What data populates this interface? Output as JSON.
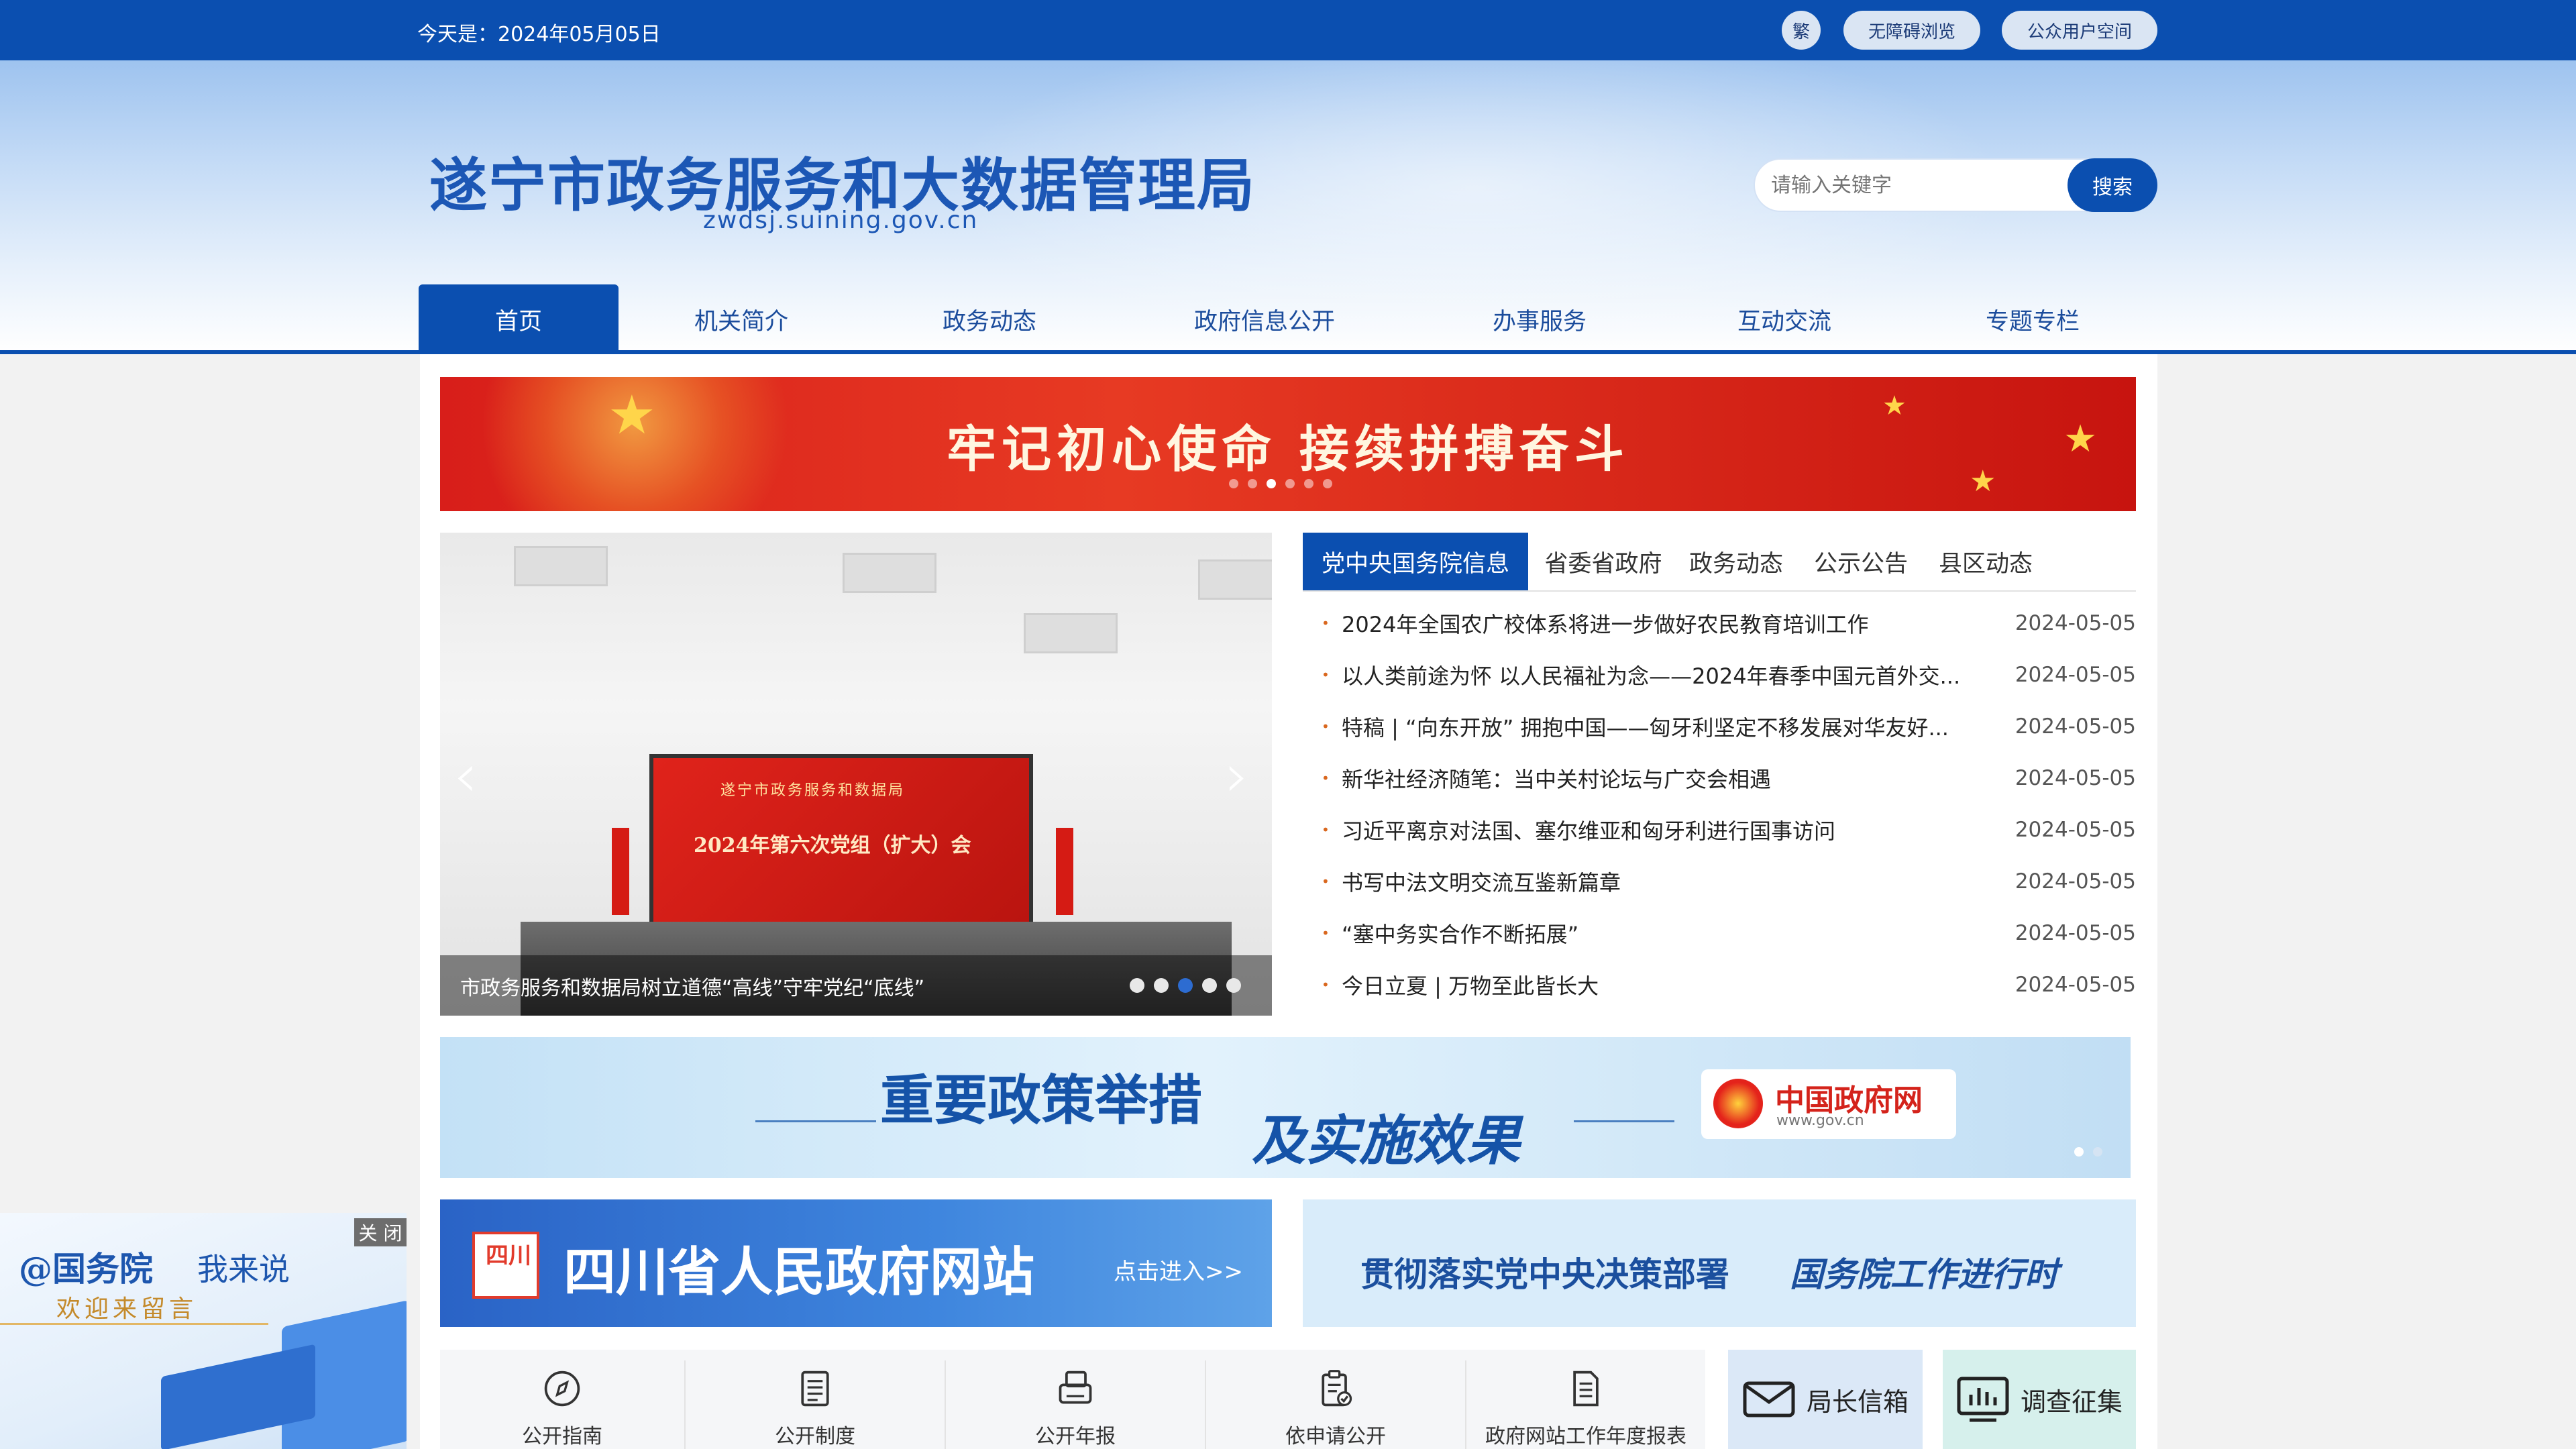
{
  "topbar": {
    "date": "今天是：2024年05月05日",
    "traditional": "繁",
    "accessibility": "无障碍浏览",
    "user_space": "公众用户空间"
  },
  "header": {
    "site_title": "遂宁市政务服务和大数据管理局",
    "domain": "zwdsj.suining.gov.cn",
    "search_placeholder": "请输入关键字",
    "search_button": "搜索"
  },
  "nav": {
    "items": [
      "首页",
      "机关简介",
      "政务动态",
      "政府信息公开",
      "办事服务",
      "互动交流",
      "专题专栏"
    ]
  },
  "banner1": {
    "slogan": "牢记初心使命    接续拼搏奋斗"
  },
  "slider": {
    "screen_line1": "遂宁市政务服务和数据局",
    "screen_line2": "2024年第六次党组（扩大）会",
    "caption": "市政务服务和数据局树立道德“高线”守牢党纪“底线”",
    "prev": "‹",
    "next": "›",
    "active_index": 2
  },
  "news": {
    "tabs": [
      "党中央国务院信息",
      "省委省政府",
      "政务动态",
      "公示公告",
      "县区动态"
    ],
    "items": [
      {
        "title": "2024年全国农广校体系将进一步做好农民教育培训工作",
        "date": "2024-05-05"
      },
      {
        "title": "以人类前途为怀 以人民福祉为念——2024年春季中国元首外交...",
        "date": "2024-05-05"
      },
      {
        "title": "特稿 | “向东开放” 拥抱中国——匈牙利坚定不移发展对华友好...",
        "date": "2024-05-05"
      },
      {
        "title": "新华社经济随笔：当中关村论坛与广交会相遇",
        "date": "2024-05-05"
      },
      {
        "title": "习近平离京对法国、塞尔维亚和匈牙利进行国事访问",
        "date": "2024-05-05"
      },
      {
        "title": "书写中法文明交流互鉴新篇章",
        "date": "2024-05-05"
      },
      {
        "title": "“塞中务实合作不断拓展”",
        "date": "2024-05-05"
      },
      {
        "title": "今日立夏 | 万物至此皆长大",
        "date": "2024-05-05"
      }
    ]
  },
  "policy_banner": {
    "title1": "重要政策举措",
    "title2": "及实施效果",
    "gov_name": "中国政府网",
    "gov_url": "www.gov.cn"
  },
  "sichuan_banner": {
    "seal": "四川",
    "name": "四川省人民政府网站",
    "enter": "点击进入>>"
  },
  "implement_banner": {
    "text1": "贯彻落实党中央决策部署",
    "text2": "国务院工作进行时"
  },
  "quick_links": [
    "公开指南",
    "公开制度",
    "公开年报",
    "依申请公开",
    "政府网站工作年度报表"
  ],
  "side_links": {
    "mailbox": "局长信箱",
    "survey": "调查征集"
  },
  "floating": {
    "line1": "@国务院",
    "line2": "我来说",
    "line3": "欢迎来留言",
    "close": "关 闭"
  },
  "colors": {
    "primary": "#0b4fb0",
    "banner_red": "#d81e1a",
    "bullet": "#d9671e"
  }
}
